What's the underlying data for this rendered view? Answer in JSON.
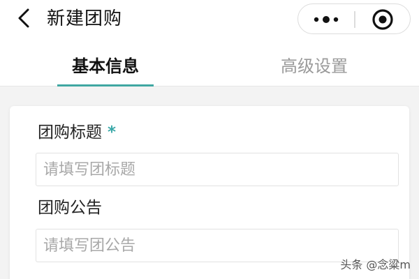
{
  "header": {
    "back_icon": "chevron-left-icon",
    "title": "新建团购",
    "capsule": {
      "more_icon": "more-dots-icon",
      "close_icon": "target-circle-icon"
    }
  },
  "tabs": [
    {
      "label": "基本信息",
      "active": true
    },
    {
      "label": "高级设置",
      "active": false
    }
  ],
  "accent_color": "#3fa7a2",
  "form": {
    "title_field": {
      "label": "团购标题",
      "required_mark": "*",
      "value": "",
      "placeholder": "请填写团标题"
    },
    "notice_field": {
      "label": "团购公告",
      "value": "",
      "placeholder": "请填写团公告"
    }
  },
  "watermark": "头条 @念粱m"
}
